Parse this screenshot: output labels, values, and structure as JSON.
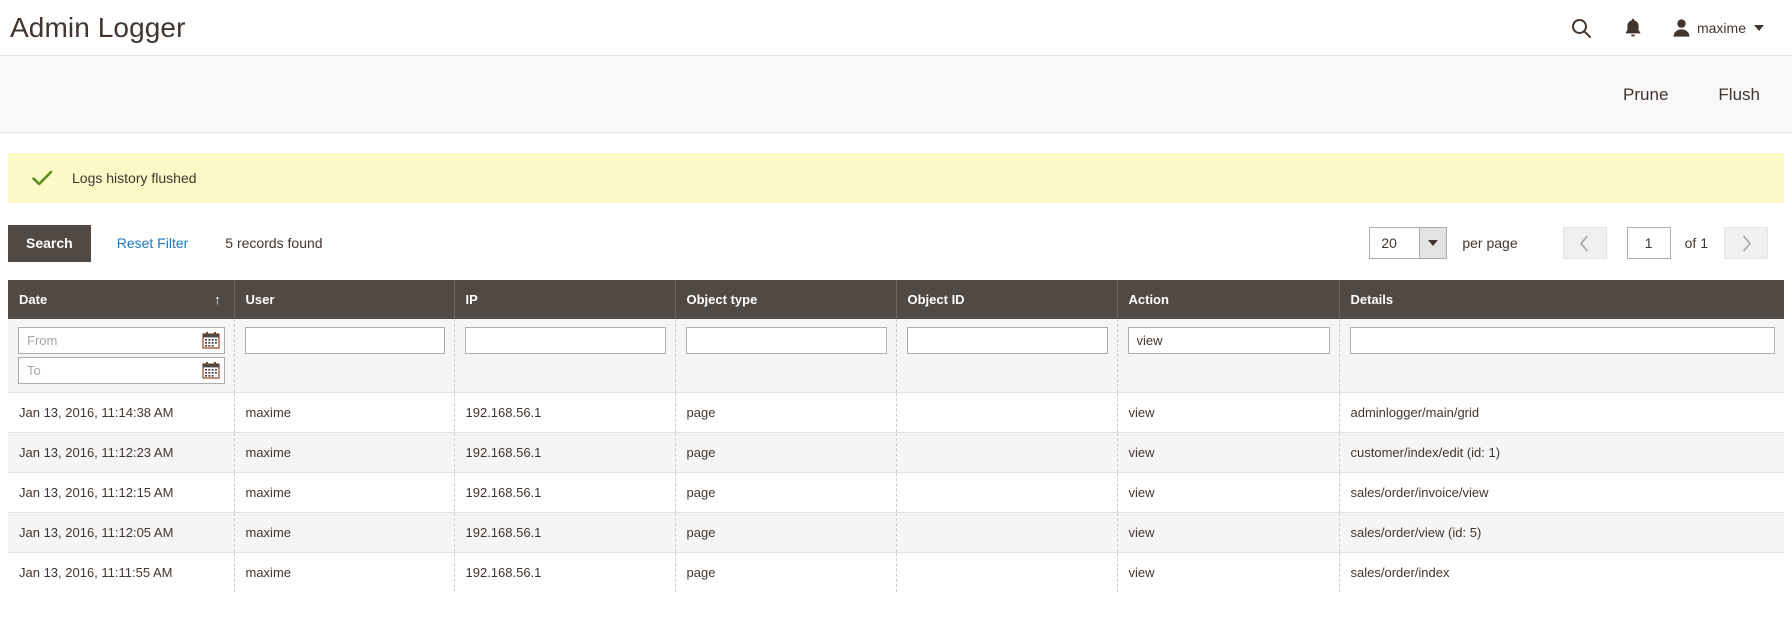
{
  "header": {
    "title": "Admin Logger",
    "search_icon": "search-icon",
    "notifications_icon": "bell-icon",
    "user_name": "maxime",
    "user_icon": "user-avatar-icon",
    "caret_icon": "chevron-down-icon"
  },
  "action_bar": {
    "prune_label": "Prune",
    "flush_label": "Flush"
  },
  "message": {
    "icon": "checkmark-icon",
    "text": "Logs history flushed",
    "background": "#fdf9c7",
    "icon_color": "#5b8f1f"
  },
  "grid_toolbar": {
    "search_label": "Search",
    "reset_filter_label": "Reset Filter",
    "records_found": "5 records found",
    "per_page_value": "20",
    "per_page_label": "per page",
    "prev_icon": "chevron-left-icon",
    "next_icon": "chevron-right-icon",
    "current_page": "1",
    "of_total": "of 1"
  },
  "grid": {
    "columns": [
      {
        "label": "Date",
        "sorted": true,
        "sort_icon": "↑"
      },
      {
        "label": "User",
        "sorted": false,
        "sort_icon": ""
      },
      {
        "label": "IP",
        "sorted": false,
        "sort_icon": ""
      },
      {
        "label": "Object type",
        "sorted": false,
        "sort_icon": ""
      },
      {
        "label": "Object ID",
        "sorted": false,
        "sort_icon": ""
      },
      {
        "label": "Action",
        "sorted": false,
        "sort_icon": ""
      },
      {
        "label": "Details",
        "sorted": false,
        "sort_icon": ""
      }
    ],
    "filters": {
      "date_from_placeholder": "From",
      "date_to_placeholder": "To",
      "date_from_value": "",
      "date_to_value": "",
      "user_value": "",
      "ip_value": "",
      "object_type_value": "",
      "object_id_value": "",
      "action_value": "view",
      "details_value": "",
      "calendar_icon": "calendar-icon"
    },
    "rows": [
      {
        "date": "Jan 13, 2016, 11:14:38 AM",
        "user": "maxime",
        "ip": "192.168.56.1",
        "object_type": "page",
        "object_id": "",
        "action": "view",
        "details": "adminlogger/main/grid"
      },
      {
        "date": "Jan 13, 2016, 11:12:23 AM",
        "user": "maxime",
        "ip": "192.168.56.1",
        "object_type": "page",
        "object_id": "",
        "action": "view",
        "details": "customer/index/edit (id: 1)"
      },
      {
        "date": "Jan 13, 2016, 11:12:15 AM",
        "user": "maxime",
        "ip": "192.168.56.1",
        "object_type": "page",
        "object_id": "",
        "action": "view",
        "details": "sales/order/invoice/view"
      },
      {
        "date": "Jan 13, 2016, 11:12:05 AM",
        "user": "maxime",
        "ip": "192.168.56.1",
        "object_type": "page",
        "object_id": "",
        "action": "view",
        "details": "sales/order/view (id: 5)"
      },
      {
        "date": "Jan 13, 2016, 11:11:55 AM",
        "user": "maxime",
        "ip": "192.168.56.1",
        "object_type": "page",
        "object_id": "",
        "action": "view",
        "details": "sales/order/index"
      }
    ]
  },
  "colors": {
    "header_bg": "#514943",
    "accent_link": "#1979c3",
    "message_bg": "#fdf9c7",
    "toolbar_bg": "#f8f8f8"
  }
}
